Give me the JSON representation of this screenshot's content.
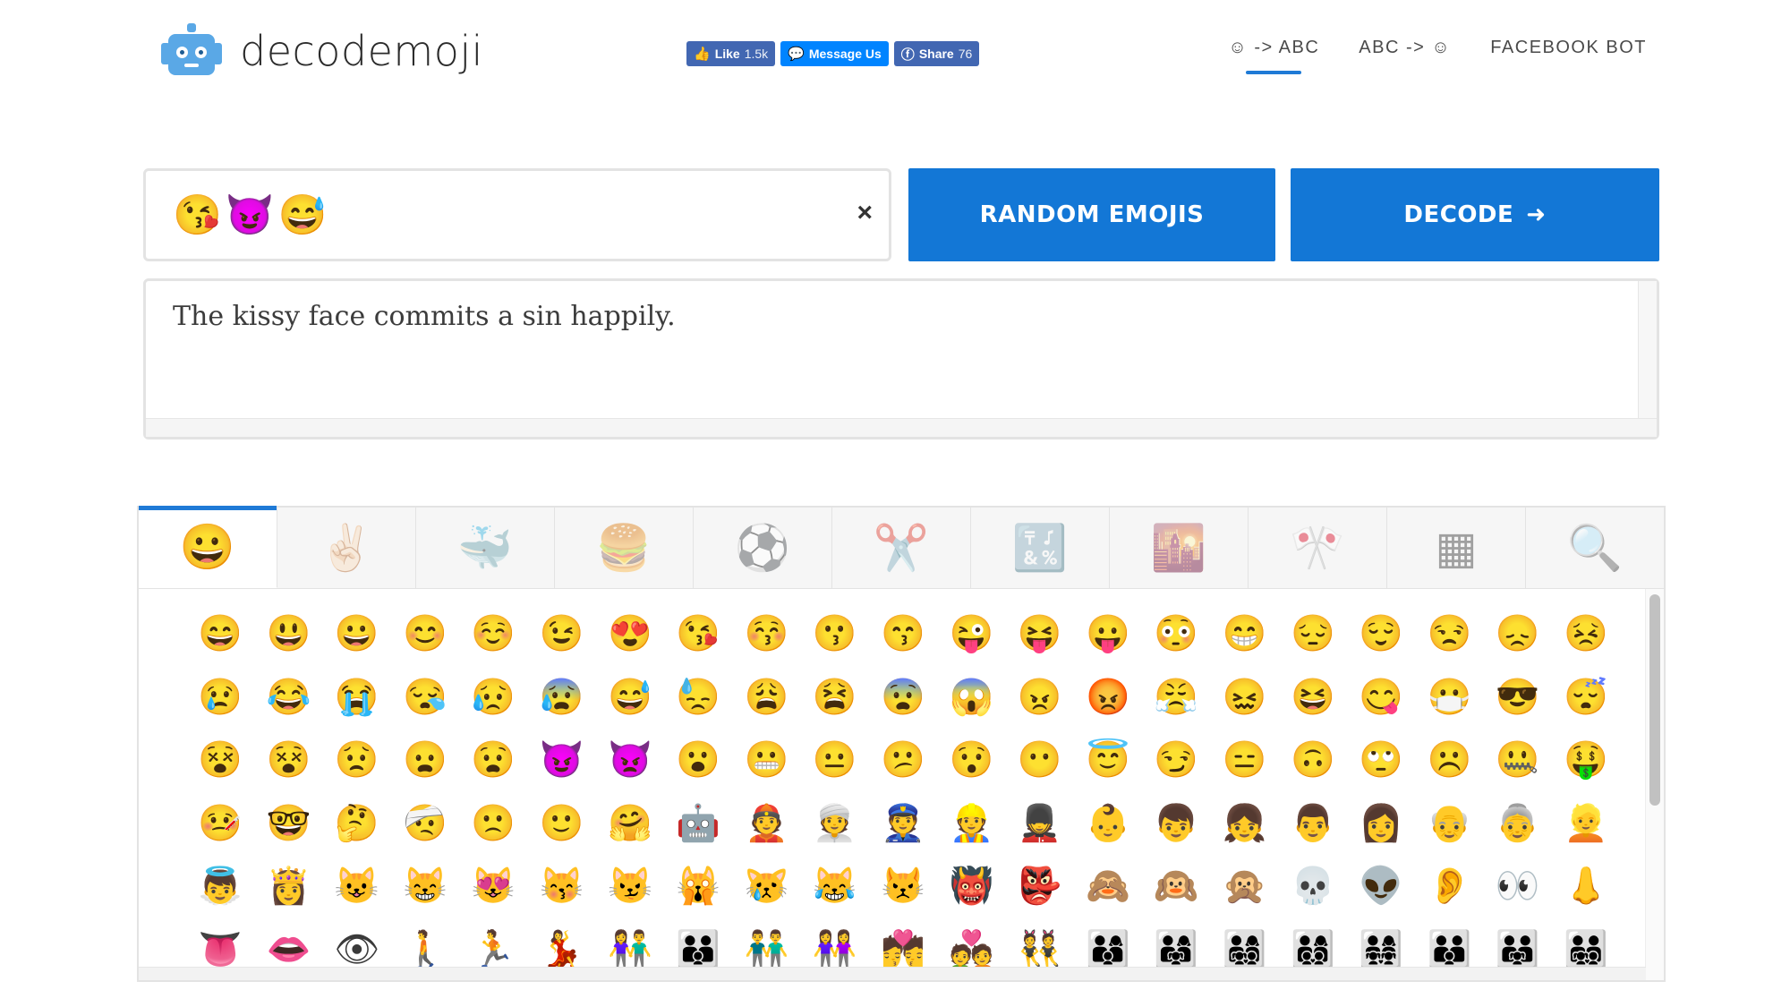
{
  "brand": {
    "name": "decodemoji"
  },
  "social": {
    "like_label": "Like",
    "like_count": "1.5k",
    "message_label": "Message Us",
    "share_label": "Share",
    "share_count": "76"
  },
  "nav": [
    {
      "label": "☺ -> ABC",
      "active": true
    },
    {
      "label": "ABC -> ☺",
      "active": false
    },
    {
      "label": "FACEBOOK BOT",
      "active": false
    }
  ],
  "input": {
    "value": "😘😈😅",
    "clear_glyph": "×"
  },
  "buttons": {
    "random": "RANDOM EMOJIS",
    "decode": "DECODE",
    "decode_arrow": "➜"
  },
  "output": {
    "text": "The kissy face commits a sin happily."
  },
  "picker": {
    "tabs": [
      {
        "icon": "😀",
        "name": "smileys",
        "active": true
      },
      {
        "icon": "✌🏻",
        "name": "people"
      },
      {
        "icon": "🐳",
        "name": "nature"
      },
      {
        "icon": "🍔",
        "name": "food"
      },
      {
        "icon": "⚽",
        "name": "activity"
      },
      {
        "icon": "✂️",
        "name": "objects"
      },
      {
        "icon": "🔣",
        "name": "symbols"
      },
      {
        "icon": "🌇",
        "name": "places"
      },
      {
        "icon": "🎌",
        "name": "flags"
      },
      {
        "icon": "▦",
        "name": "recent"
      },
      {
        "icon": "🔍",
        "name": "search"
      }
    ],
    "rows": [
      [
        "😄",
        "😃",
        "😀",
        "😊",
        "☺️",
        "😉",
        "😍",
        "😘",
        "😚",
        "😗",
        "😙",
        "😜",
        "😝",
        "😛",
        "😳",
        "😁",
        "😔",
        "😌",
        "😒",
        "😞",
        "😣"
      ],
      [
        "😢",
        "😂",
        "😭",
        "😪",
        "😥",
        "😰",
        "😅",
        "😓",
        "😩",
        "😫",
        "😨",
        "😱",
        "😠",
        "😡",
        "😤",
        "😖",
        "😆",
        "😋",
        "😷",
        "😎",
        "😴"
      ],
      [
        "😵",
        "😵",
        "😟",
        "😦",
        "😧",
        "😈",
        "👿",
        "😮",
        "😬",
        "😐",
        "😕",
        "😯",
        "😶",
        "😇",
        "😏",
        "😑",
        "🙃",
        "🙄",
        "☹️",
        "🤐",
        "🤑"
      ],
      [
        "🤒",
        "🤓",
        "🤔",
        "🤕",
        "🙁",
        "🙂",
        "🤗",
        "🤖",
        "👲",
        "👳",
        "👮",
        "👷",
        "💂",
        "👶",
        "👦",
        "👧",
        "👨",
        "👩",
        "👴",
        "👵",
        "👱"
      ],
      [
        "👼",
        "👸",
        "😺",
        "😸",
        "😻",
        "😽",
        "😼",
        "🙀",
        "😿",
        "😹",
        "😾",
        "👹",
        "👺",
        "🙈",
        "🙉",
        "🙊",
        "💀",
        "👽",
        "👂",
        "👀",
        "👃"
      ],
      [
        "👅",
        "👄",
        "👁",
        "🚶",
        "🏃",
        "💃",
        "👫",
        "👪",
        "👬",
        "👭",
        "💏",
        "💑",
        "👯",
        "👨‍👩‍👦",
        "👨‍👩‍👧",
        "👨‍👩‍👧‍👦",
        "👨‍👩‍👦‍👦",
        "👨‍👩‍👧‍👧",
        "👨‍👨‍👦",
        "👨‍👨‍👧",
        "👨‍👨‍👧‍👦"
      ]
    ]
  }
}
